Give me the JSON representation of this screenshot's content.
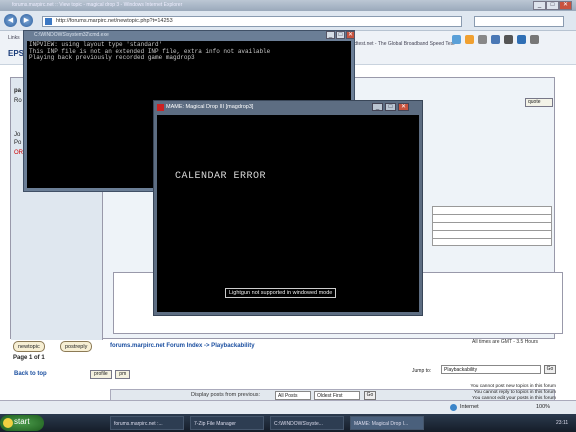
{
  "browser": {
    "title": "forums.marpirc.net :: View topic - magical drop 3 - Windows Internet Explorer",
    "address": "http://forums.marpirc.net/newtopic.php?t=14253",
    "favorites_left": "Links",
    "favorites_bold": "EPS",
    "speedtest_text": "peedtest.net - The Global Broadband Speed Test",
    "minimize": "_",
    "maximize": "□",
    "close": "✕",
    "back_icon": "◀",
    "forward_icon": "▶"
  },
  "forum": {
    "quote_label": "quote",
    "back_to_top": "Back to top",
    "profile_label": "profile",
    "pm_label": "pm",
    "display_label": "Display posts from previous:",
    "display_value": "All Posts",
    "order_value": "Oldest First",
    "go_label": "Go",
    "new_topic": "newtopic",
    "post_reply": "postreply",
    "nav_path": "forums.marpirc.net Forum Index -> Playbackability",
    "timezone": "All times are GMT - 3.5 Hours",
    "page_of": "Page 1 of 1",
    "jump_to": "Jump to:",
    "jump_value": "Playbackability",
    "permissions": [
      "You cannot post new topics in this forum",
      "You cannot reply to topics in this forum",
      "You cannot edit your posts in this forum"
    ],
    "left_col_snippets": [
      "pa",
      "Ro",
      "Jo",
      "Po",
      "OR"
    ]
  },
  "cmd_window": {
    "title": "C:\\WINDOWS\\system32\\cmd.exe",
    "lines": [
      "INPVIEW: using layout type 'standard'",
      "This INP file is not an extended INP file, extra info not available",
      "Playing back previously recorded game magdrop3"
    ],
    "min": "_",
    "max": "□",
    "close": "✕"
  },
  "mame_window": {
    "title": "MAME: Magical Drop III [magdrop3]",
    "screen_text": "CALENDAR ERROR",
    "lightgun_msg": "Lightgun not supported in windowed mode",
    "min": "_",
    "max": "□",
    "close": "✕"
  },
  "statusbar": {
    "zone": "Internet",
    "zoom": "100%"
  },
  "taskbar": {
    "start": "start",
    "tasks": [
      "forums.marpirc.net :...",
      "7-Zip File Manager",
      "C:\\WINDOWS\\syste...",
      "MAME: Magical Drop I..."
    ],
    "clock": "23:11"
  },
  "colors": {
    "accent": "#1b4fa0",
    "taskbar": "#151d28",
    "console_bg": "#000000"
  }
}
